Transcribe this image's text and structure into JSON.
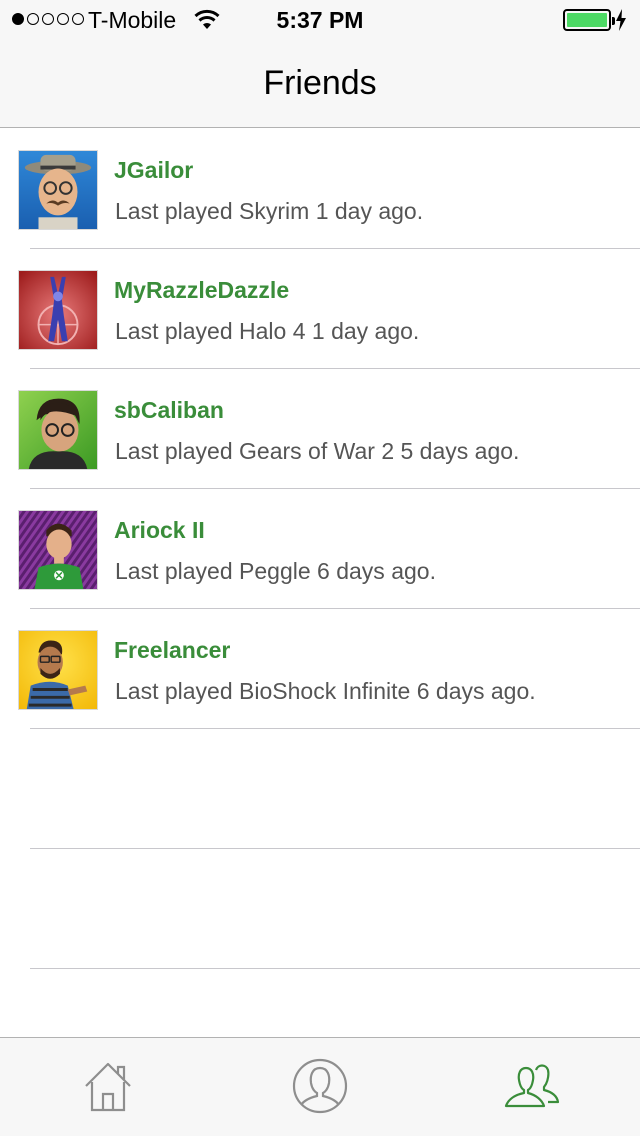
{
  "status_bar": {
    "carrier": "T-Mobile",
    "time": "5:37 PM",
    "signal_bars_filled": 1,
    "signal_bars_total": 5,
    "battery_color": "#4cd964"
  },
  "nav": {
    "title": "Friends"
  },
  "friends": [
    {
      "name": "JGailor",
      "status": "Last played Skyrim 1 day ago."
    },
    {
      "name": "MyRazzleDazzle",
      "status": "Last played Halo 4 1 day ago."
    },
    {
      "name": "sbCaliban",
      "status": "Last played Gears of War 2 5 days ago."
    },
    {
      "name": "Ariock II",
      "status": "Last played Peggle 6 days ago."
    },
    {
      "name": "Freelancer",
      "status": "Last played BioShock Infinite 6 days ago."
    }
  ],
  "tabs": [
    {
      "icon": "home-icon",
      "selected": false
    },
    {
      "icon": "profile-icon",
      "selected": false
    },
    {
      "icon": "friends-icon",
      "selected": true
    }
  ],
  "colors": {
    "accent": "#3a8d3a",
    "tab_inactive": "#8e8e8e"
  }
}
